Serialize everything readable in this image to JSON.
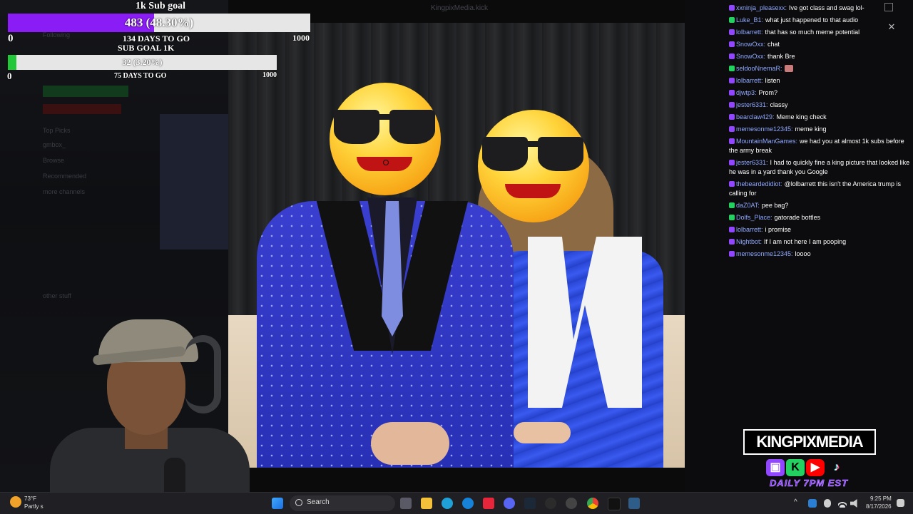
{
  "goals": {
    "main": {
      "title": "1k Sub goal",
      "progress_text": "483 (48.30%)",
      "progress": 0.483,
      "min": "0",
      "max": "1000",
      "days_to_go": "134 DAYS TO GO"
    },
    "secondary": {
      "title": "SUB GOAL 1K",
      "progress_text": "32 (3.20%)",
      "progress": 0.032,
      "min": "0",
      "max": "1000",
      "days_to_go": "75 DAYS TO GO"
    },
    "colors": {
      "main_fill": "#8a1cf5",
      "secondary_fill": "#22c83a"
    }
  },
  "background": {
    "window_title": "KingpixMedia.kick",
    "sidebar_items": [
      "Following",
      "Top Picks",
      "gmbox_",
      "Browse",
      "Recommended",
      "more channels",
      "other stuff"
    ]
  },
  "chat": {
    "messages": [
      {
        "platform": "twitch",
        "user": "xxninja_pleasexx:",
        "text": "Ive got class and swag lol-"
      },
      {
        "platform": "kick",
        "user": "Luke_B1:",
        "text": "what just happened to that audio"
      },
      {
        "platform": "twitch",
        "user": "lolbarrett:",
        "text": "that has so much meme potential"
      },
      {
        "platform": "twitch",
        "user": "SnowOxx:",
        "text": "chat"
      },
      {
        "platform": "twitch",
        "user": "SnowOxx:",
        "text": "thank Bre"
      },
      {
        "platform": "kick",
        "user": "seldooNnemaR:",
        "text": "",
        "emote": "emote"
      },
      {
        "platform": "twitch",
        "user": "lolbarrett:",
        "text": "listen"
      },
      {
        "platform": "twitch",
        "user": "djwtp3:",
        "text": "Prom?"
      },
      {
        "platform": "twitch",
        "user": "jester6331:",
        "text": "classy"
      },
      {
        "platform": "twitch",
        "user": "bearclaw429:",
        "text": "Meme king check"
      },
      {
        "platform": "twitch",
        "user": "memesonme12345:",
        "text": "meme king"
      },
      {
        "platform": "twitch",
        "user": "MountainManGames:",
        "text": "we had you at almost 1k subs before the army break"
      },
      {
        "platform": "twitch",
        "user": "jester6331:",
        "text": "I had to quickly fine a king picture that looked like he was in a yard thank you Google"
      },
      {
        "platform": "twitch",
        "user": "thebeardedidiot:",
        "text": "@lolbarrett this isn't the America trump is calling for"
      },
      {
        "platform": "kick",
        "user": "daZ0AT:",
        "text": "pee bag?"
      },
      {
        "platform": "kick",
        "user": "Dolfs_Place:",
        "text": "gatorade bottles"
      },
      {
        "platform": "twitch",
        "user": "lolbarrett:",
        "text": "i promise"
      },
      {
        "platform": "twitch",
        "user": "Nightbot:",
        "text": "If I am not here I am pooping"
      },
      {
        "platform": "twitch",
        "user": "memesonme12345:",
        "text": "loooo"
      }
    ],
    "close_glyph": "✕",
    "colors": {
      "username": "#8fa8ff",
      "twitch_badge": "#9146ff",
      "kick_badge": "#23d160"
    }
  },
  "branding": {
    "name": "KINGPIXMEDIA",
    "schedule": "DAILY 7PM EST",
    "icons": [
      {
        "name": "twitch-icon",
        "glyph": "▣",
        "color": "#9146ff"
      },
      {
        "name": "kick-icon",
        "glyph": "K",
        "color": "#23d160"
      },
      {
        "name": "youtube-icon",
        "glyph": "▶",
        "color": "#ff0000"
      },
      {
        "name": "tiktok-icon",
        "glyph": "♪",
        "color": "#000000"
      }
    ]
  },
  "taskbar": {
    "weather_temp": "73°F",
    "weather_desc": "Partly s",
    "search_label": "Search",
    "time": "9:25 PM",
    "date": "8/17/2026"
  }
}
